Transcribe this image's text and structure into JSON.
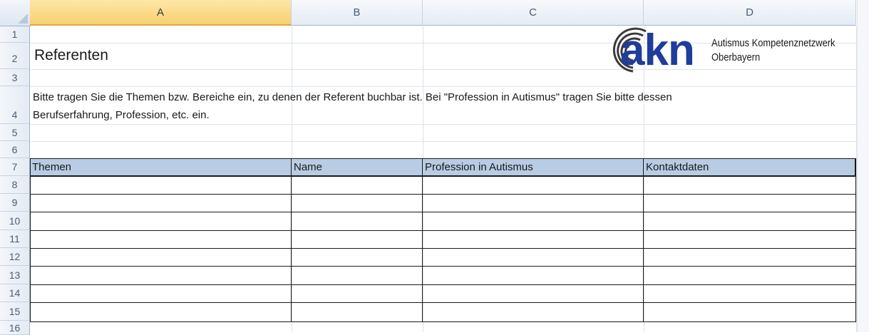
{
  "columns": [
    "A",
    "B",
    "C",
    "D"
  ],
  "rows": [
    "1",
    "2",
    "3",
    "4",
    "5",
    "6",
    "7",
    "8",
    "9",
    "10",
    "11",
    "12",
    "13",
    "14",
    "15",
    "16"
  ],
  "title": "Referenten",
  "instruction_line1": "Bitte tragen Sie die Themen bzw. Bereiche ein, zu denen der Referent buchbar ist. Bei \"Profession in Autismus\" tragen Sie bitte dessen",
  "instruction_line2": "Berufserfahrung, Profession, etc. ein.",
  "table_headers": [
    "Themen",
    "Name",
    "Profession in Autismus",
    "Kontaktdaten"
  ],
  "logo": {
    "word": "akn",
    "tagline_line1": "Autismus Kompetenznetzwerk",
    "tagline_line2": "Oberbayern",
    "brand_color": "#1f3d9b"
  },
  "colors": {
    "header_fill": "#b8cce4",
    "selected_column": "#f8cf72"
  }
}
